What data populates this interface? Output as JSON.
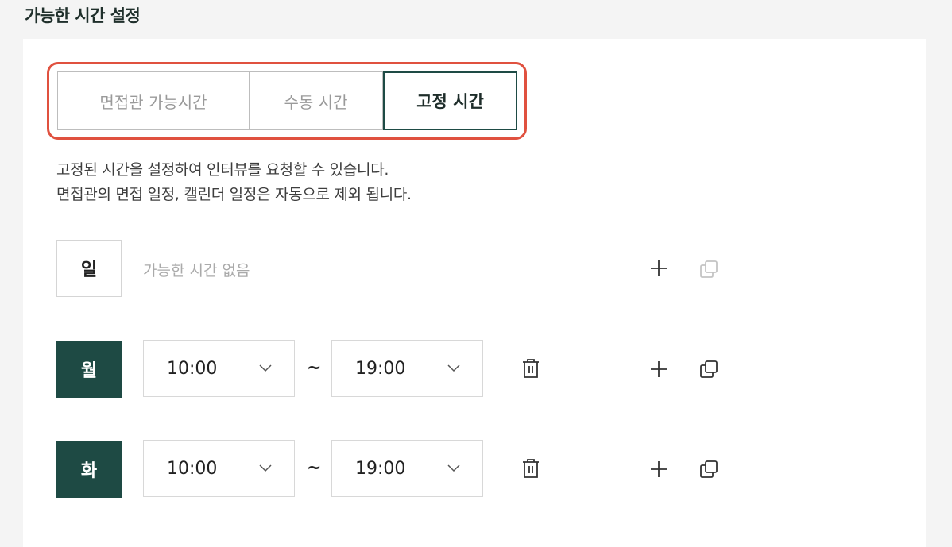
{
  "section": {
    "title": "가능한 시간 설정"
  },
  "tabs": [
    {
      "label": "면접관 가능시간",
      "selected": false
    },
    {
      "label": "수동 시간",
      "selected": false
    },
    {
      "label": "고정 시간",
      "selected": true
    }
  ],
  "description": {
    "line1": "고정된 시간을 설정하여 인터뷰를 요청할 수 있습니다.",
    "line2": "면접관의 면접 일정, 캘린더 일정은 자동으로 제외 됩니다."
  },
  "days": [
    {
      "label": "일",
      "active": false,
      "empty_text": "가능한 시간 없음"
    },
    {
      "label": "월",
      "active": true,
      "start": "10:00",
      "end": "19:00",
      "separator": "~"
    },
    {
      "label": "화",
      "active": true,
      "start": "10:00",
      "end": "19:00",
      "separator": "~"
    }
  ],
  "icons": {
    "add": "plus-icon",
    "copy": "copy-icon",
    "delete": "trash-icon",
    "dropdown": "chevron-down-icon"
  },
  "colors": {
    "accent": "#1e4a44",
    "highlight": "#e0513f",
    "muted_text": "#aaaaaa"
  }
}
